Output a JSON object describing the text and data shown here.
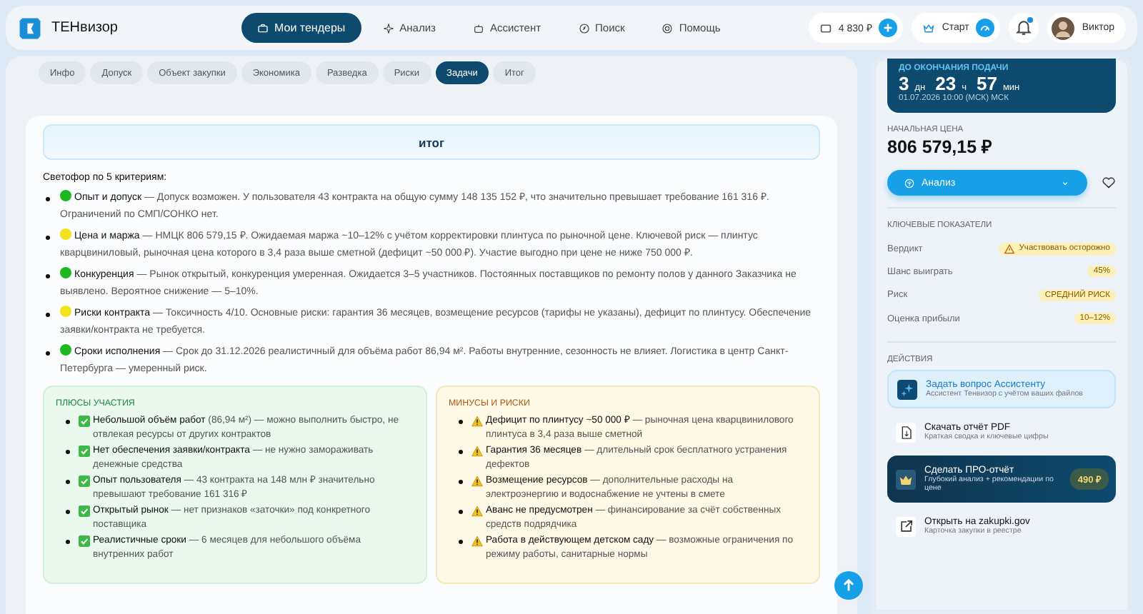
{
  "header": {
    "brand": "ТЕНвизор",
    "nav": [
      {
        "label": "Мои тендеры",
        "selected": true
      },
      {
        "label": "Анализ",
        "selected": false
      },
      {
        "label": "Ассистент",
        "selected": false
      },
      {
        "label": "Поиск",
        "selected": false
      },
      {
        "label": "Помощь",
        "selected": false
      }
    ],
    "balance": "4 830 ₽",
    "plan": "Старт",
    "user": "Виктор",
    "notification": true
  },
  "tabs": [
    {
      "label": "Инфо",
      "selected": false
    },
    {
      "label": "Допуск",
      "selected": false
    },
    {
      "label": "Объект закупки",
      "selected": false
    },
    {
      "label": "Экономика",
      "selected": false
    },
    {
      "label": "Разведка",
      "selected": false
    },
    {
      "label": "Риски",
      "selected": false
    },
    {
      "label": "Задачи",
      "selected": true
    },
    {
      "label": "Итог",
      "selected": false
    }
  ],
  "summary": {
    "title": "итог",
    "intro": "Светофор по 5 критериям:",
    "criteria": [
      {
        "color": "#1fb81f",
        "title": "Опыт и допуск",
        "text": "— Допуск возможен. У пользователя 43 контракта на общую сумму 148 135 152 ₽, что значительно превышает требование 161 316 ₽. Ограничений по СМП/СОНКО нет."
      },
      {
        "color": "#f5e31a",
        "title": "Цена и маржа",
        "text": "— НМЦК 806 579,15 ₽. Ожидаемая маржа ~10–12% с учётом корректировки плинтуса по рыночной цене. Ключевой риск — плинтус кварцвиниловый, рыночная цена которого в 3,4 раза выше сметной (дефицит ~50 000 ₽). Участие выгодно при цене не ниже 750 000 ₽."
      },
      {
        "color": "#1fb81f",
        "title": "Конкуренция",
        "text": "— Рынок открытый, конкуренция умеренная. Ожидается 3–5 участников. Постоянных поставщиков по ремонту полов у данного Заказчика не выявлено. Вероятное снижение — 5–10%."
      },
      {
        "color": "#f5e31a",
        "title": "Риски контракта",
        "text": "— Токсичность 4/10. Основные риски: гарантия 36 месяцев, возмещение ресурсов (тарифы не указаны), дефицит по плинтусу. Обеспечение заявки/контракта не требуется."
      },
      {
        "color": "#1fb81f",
        "title": "Сроки исполнения",
        "text": "— Срок до 31.12.2026 реалистичный для объёма работ 86,94 м². Работы внутренние, сезонность не влияет. Логистика в центр Санкт-Петербурга — умеренный риск."
      }
    ],
    "boxes": [
      {
        "kind": "pros",
        "title": "ПЛЮСЫ УЧАСТИЯ",
        "items": [
          {
            "title": "Небольшой объём работ",
            "text": "(86,94 м²) — можно выполнить быстро, не отвлекая ресурсы от других контрактов"
          },
          {
            "title": "Нет обеспечения заявки/контракта",
            "text": "— не нужно замораживать денежные средства"
          },
          {
            "title": "Опыт пользователя",
            "text": "— 43 контракта на 148 млн ₽ значительно превышают требование 161 316 ₽"
          },
          {
            "title": "Открытый рынок",
            "text": "— нет признаков «заточки» под конкретного поставщика"
          },
          {
            "title": "Реалистичные сроки",
            "text": "— 6 месяцев для небольшого объёма внутренних работ"
          }
        ]
      },
      {
        "kind": "cons",
        "title": "МИНУСЫ И РИСКИ",
        "items": [
          {
            "title": "Дефицит по плинтусу ~50 000 ₽",
            "text": "— рыночная цена кварцвинилового плинтуса в 3,4 раза выше сметной"
          },
          {
            "title": "Гарантия 36 месяцев",
            "text": "— длительный срок бесплатного устранения дефектов"
          },
          {
            "title": "Возмещение ресурсов",
            "text": "— дополнительные расходы на электроэнергию и водоснабжение не учтены в смете"
          },
          {
            "title": "Аванс не предусмотрен",
            "text": "— финансирование за счёт собственных средств подрядчика"
          },
          {
            "title": "Работа в действующем детском саду",
            "text": "— возможные ограничения по режиму работы, санитарные нормы"
          }
        ]
      }
    ]
  },
  "sidebar": {
    "deadline": {
      "label": "ДО ОКОНЧАНИЯ ПОДАЧИ",
      "days": "3",
      "days_unit": "дн",
      "hours": "23",
      "hours_unit": "ч",
      "minutes": "57",
      "minutes_unit": "мин",
      "date": "01.07.2026 10:00 (МСК) МСК"
    },
    "price_label": "НАЧАЛЬНАЯ ЦЕНА",
    "price": "806 579,15 ₽",
    "analyze_button": "Анализ",
    "metrics_title": "КЛЮЧЕВЫЕ ПОКАЗАТЕЛИ",
    "metrics": [
      {
        "label": "Вердикт",
        "value": "Участвовать осторожно",
        "warning": true
      },
      {
        "label": "Шанс выиграть",
        "value": "45%",
        "warning": false
      },
      {
        "label": "Риск",
        "value": "СРЕДНИЙ РИСК",
        "warning": false
      },
      {
        "label": "Оценка прибыли",
        "value": "10–12%",
        "warning": false
      }
    ],
    "actions_title": "ДЕЙСТВИЯ",
    "actions": [
      {
        "kind": "assistant",
        "title": "Задать вопрос Ассистенту",
        "subtitle": "Ассистент Тенвизор с учётом ваших файлов"
      },
      {
        "kind": "pdf",
        "title": "Скачать отчёт PDF",
        "subtitle": "Краткая сводка и ключевые цифры"
      },
      {
        "kind": "pro",
        "title": "Сделать ПРО-отчёт",
        "subtitle": "Глубокий анализ + рекомендации по цене",
        "price": "490 ₽"
      },
      {
        "kind": "external",
        "title": "Открыть на zakupki.gov",
        "subtitle": "Карточка закупки в реестре"
      }
    ]
  }
}
